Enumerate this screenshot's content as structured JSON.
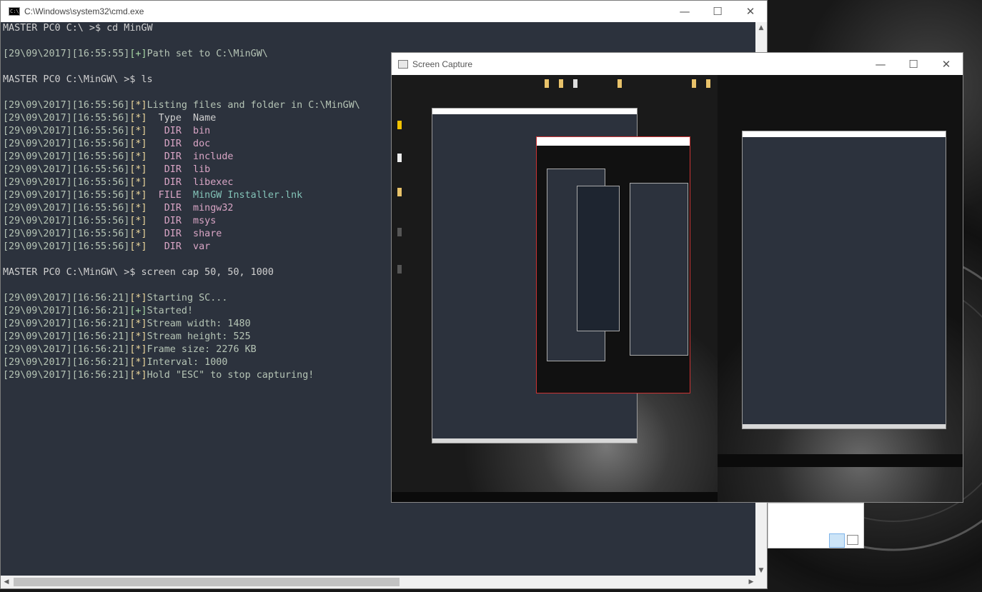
{
  "cmd": {
    "title": "C:\\Windows\\system32\\cmd.exe",
    "icon_text": "C:\\",
    "lines": [
      {
        "kind": "prompt",
        "text": "MASTER PC0 C:\\ >$ cd MinGW"
      },
      {
        "kind": "blank",
        "text": ""
      },
      {
        "kind": "log",
        "stamp": "[29\\09\\2017][16:55:55]",
        "tag": "[+]",
        "msg": "Path set to C:\\MinGW\\"
      },
      {
        "kind": "blank",
        "text": ""
      },
      {
        "kind": "prompt",
        "text": "MASTER PC0 C:\\MinGW\\ >$ ls"
      },
      {
        "kind": "blank",
        "text": ""
      },
      {
        "kind": "log",
        "stamp": "[29\\09\\2017][16:55:56]",
        "tag": "[*]",
        "msg": "Listing files and folder in C:\\MinGW\\"
      },
      {
        "kind": "entry",
        "stamp": "[29\\09\\2017][16:55:56]",
        "tag": "[*]",
        "type": "  Type",
        "name": "  Name",
        "header": true
      },
      {
        "kind": "entry",
        "stamp": "[29\\09\\2017][16:55:56]",
        "tag": "[*]",
        "type": "   DIR",
        "name": "  bin"
      },
      {
        "kind": "entry",
        "stamp": "[29\\09\\2017][16:55:56]",
        "tag": "[*]",
        "type": "   DIR",
        "name": "  doc"
      },
      {
        "kind": "entry",
        "stamp": "[29\\09\\2017][16:55:56]",
        "tag": "[*]",
        "type": "   DIR",
        "name": "  include"
      },
      {
        "kind": "entry",
        "stamp": "[29\\09\\2017][16:55:56]",
        "tag": "[*]",
        "type": "   DIR",
        "name": "  lib"
      },
      {
        "kind": "entry",
        "stamp": "[29\\09\\2017][16:55:56]",
        "tag": "[*]",
        "type": "   DIR",
        "name": "  libexec"
      },
      {
        "kind": "entry",
        "stamp": "[29\\09\\2017][16:55:56]",
        "tag": "[*]",
        "type": "  FILE",
        "name": "  MinGW Installer.lnk",
        "file": true
      },
      {
        "kind": "entry",
        "stamp": "[29\\09\\2017][16:55:56]",
        "tag": "[*]",
        "type": "   DIR",
        "name": "  mingw32"
      },
      {
        "kind": "entry",
        "stamp": "[29\\09\\2017][16:55:56]",
        "tag": "[*]",
        "type": "   DIR",
        "name": "  msys"
      },
      {
        "kind": "entry",
        "stamp": "[29\\09\\2017][16:55:56]",
        "tag": "[*]",
        "type": "   DIR",
        "name": "  share"
      },
      {
        "kind": "entry",
        "stamp": "[29\\09\\2017][16:55:56]",
        "tag": "[*]",
        "type": "   DIR",
        "name": "  var"
      },
      {
        "kind": "blank",
        "text": ""
      },
      {
        "kind": "prompt",
        "text": "MASTER PC0 C:\\MinGW\\ >$ screen cap 50, 50, 1000"
      },
      {
        "kind": "blank",
        "text": ""
      },
      {
        "kind": "log",
        "stamp": "[29\\09\\2017][16:56:21]",
        "tag": "[*]",
        "msg": "Starting SC..."
      },
      {
        "kind": "log",
        "stamp": "[29\\09\\2017][16:56:21]",
        "tag": "[+]",
        "msg": "Started!"
      },
      {
        "kind": "log",
        "stamp": "[29\\09\\2017][16:56:21]",
        "tag": "[*]",
        "msg": "Stream width: 1480"
      },
      {
        "kind": "log",
        "stamp": "[29\\09\\2017][16:56:21]",
        "tag": "[*]",
        "msg": "Stream height: 525"
      },
      {
        "kind": "log",
        "stamp": "[29\\09\\2017][16:56:21]",
        "tag": "[*]",
        "msg": "Frame size: 2276 KB"
      },
      {
        "kind": "log",
        "stamp": "[29\\09\\2017][16:56:21]",
        "tag": "[*]",
        "msg": "Interval: 1000"
      },
      {
        "kind": "log",
        "stamp": "[29\\09\\2017][16:56:21]",
        "tag": "[*]",
        "msg": "Hold \"ESC\" to stop capturing!"
      }
    ],
    "buttons": {
      "minimize": "—",
      "maximize": "☐",
      "close": "✕"
    },
    "scroll": {
      "up": "▲",
      "down": "▼",
      "left": "◀",
      "right": "▶"
    }
  },
  "screen_capture": {
    "title": "Screen Capture",
    "buttons": {
      "minimize": "—",
      "maximize": "☐",
      "close": "✕"
    }
  },
  "colors": {
    "console_bg": "#2c323d",
    "console_text": "#d0d0d0",
    "tag_star": "#ecd79c",
    "tag_plus": "#a9d8a6",
    "dir_type": "#d9a5c5",
    "file_name": "#83c3b8"
  }
}
